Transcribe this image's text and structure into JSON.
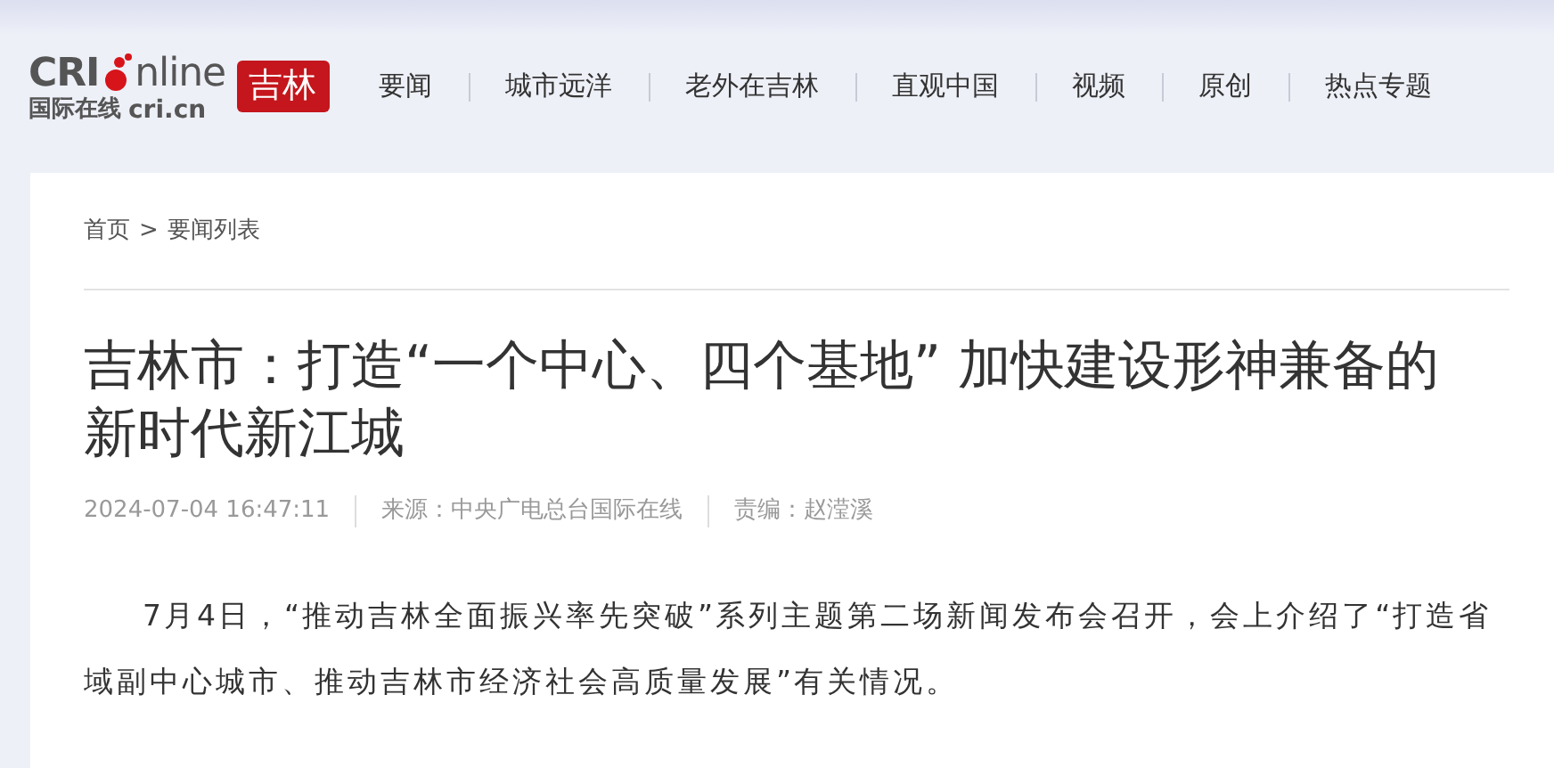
{
  "logo": {
    "brand_left": "CRI",
    "brand_right": "nline",
    "subtitle_cn": "国际在线",
    "subtitle_domain": "cri.cn",
    "region": "吉林"
  },
  "nav": [
    "要闻",
    "城市远洋",
    "老外在吉林",
    "直观中国",
    "视频",
    "原创",
    "热点专题"
  ],
  "breadcrumb": {
    "home": "首页",
    "separator": ">",
    "current": "要闻列表"
  },
  "article": {
    "title": "吉林市：打造“一个中心、四个基地” 加快建设形神兼备的新时代新江城",
    "meta": [
      "2024-07-04 16:47:11",
      "来源：中央广电总台国际在线",
      "责编：赵滢溪"
    ],
    "paragraphs": [
      "7月4日，“推动吉林全面振兴率先突破”系列主题第二场新闻发布会召开，会上介绍了“打造省域副中心城市、推动吉林市经济社会高质量发展”有关情况。"
    ]
  }
}
